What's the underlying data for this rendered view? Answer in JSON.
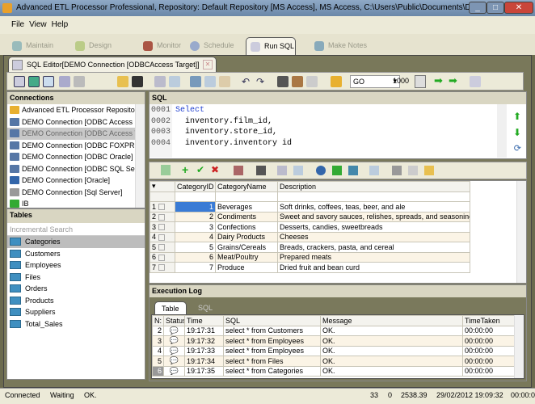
{
  "window": {
    "title": "Advanced ETL Processor Professional, Repository: Default Repository  [MS Access], MS Access, C:\\Users\\Public\\Documents\\DBSL\\..."
  },
  "menu": [
    "File",
    "View",
    "Help"
  ],
  "main_tabs": [
    {
      "label": "Maintain"
    },
    {
      "label": "Design"
    },
    {
      "label": "Monitor"
    },
    {
      "label": "Schedule"
    },
    {
      "label": "Run SQL",
      "active": true
    },
    {
      "label": "Make Notes"
    }
  ],
  "doc_tab": "SQL Editor[DEMO Connection [ODBCAccess Target]]",
  "toolbar": {
    "go_select": "GO",
    "row_limit": "1000"
  },
  "connections": {
    "title": "Connections",
    "items": [
      "Advanced ETL Processor Repository",
      "DEMO Connection [ODBC Access Source]",
      "DEMO Connection [ODBC Access Target]",
      "DEMO Connection [ODBC FOXPRO]",
      "DEMO Connection [ODBC Oracle]",
      "DEMO Connection [ODBC SQL Server]",
      "DEMO Connection [Oracle]",
      "DEMO Connection [Sql Server]",
      "IB"
    ],
    "selected": 2
  },
  "tables": {
    "title": "Tables",
    "search_placeholder": "Incremental Search",
    "items": [
      "Categories",
      "Customers",
      "Employees",
      "Files",
      "Orders",
      "Products",
      "Suppliers",
      "Total_Sales"
    ],
    "selected": 0
  },
  "sql": {
    "title": "SQL",
    "lines": [
      {
        "n": "0001",
        "text": "Select"
      },
      {
        "n": "0002",
        "text": "  inventory.film_id,"
      },
      {
        "n": "0003",
        "text": "  inventory.store_id,"
      },
      {
        "n": "0004",
        "text": "  inventory.inventory id"
      }
    ]
  },
  "grid": {
    "columns": [
      "CategoryID",
      "CategoryName",
      "Description"
    ],
    "rows": [
      [
        "1",
        "1",
        "Beverages",
        "Soft drinks, coffees, teas, beer, and ale"
      ],
      [
        "2",
        "2",
        "Condiments",
        "Sweet and savory sauces, relishes, spreads, and seasonings"
      ],
      [
        "3",
        "3",
        "Confections",
        "Desserts, candies, sweetbreads"
      ],
      [
        "4",
        "4",
        "Dairy Products",
        "Cheeses"
      ],
      [
        "5",
        "5",
        "Grains/Cereals",
        "Breads, crackers, pasta, and cereal"
      ],
      [
        "6",
        "6",
        "Meat/Poultry",
        "Prepared meats"
      ],
      [
        "7",
        "7",
        "Produce",
        "Dried fruit and bean curd"
      ]
    ]
  },
  "log": {
    "title": "Execution Log",
    "tabs": [
      "Table",
      "SQL"
    ],
    "columns": [
      "N:",
      "Status",
      "Time",
      "SQL",
      "Message",
      "TimeTaken"
    ],
    "rows": [
      [
        "2",
        "19:17:31",
        "select * from Customers",
        "OK.",
        "00:00:00"
      ],
      [
        "3",
        "19:17:32",
        "select * from Employees",
        "OK.",
        "00:00:00"
      ],
      [
        "4",
        "19:17:33",
        "select * from Employees",
        "OK.",
        "00:00:00"
      ],
      [
        "5",
        "19:17:34",
        "select * from Files",
        "OK.",
        "00:00:00"
      ],
      [
        "6",
        "19:17:35",
        "select * from Categories",
        "OK.",
        "00:00:00"
      ]
    ]
  },
  "status": {
    "connected": "Connected",
    "waiting": "Waiting",
    "message": "OK.",
    "count1": "33",
    "count2": "0",
    "value": "2538.39",
    "datetime": "29/02/2012 19:09:32",
    "elapsed": "00:00:0"
  },
  "colors": {
    "frame": "#79785a",
    "panel": "#ecead8",
    "sql_keyword": "#1f3fd0"
  }
}
